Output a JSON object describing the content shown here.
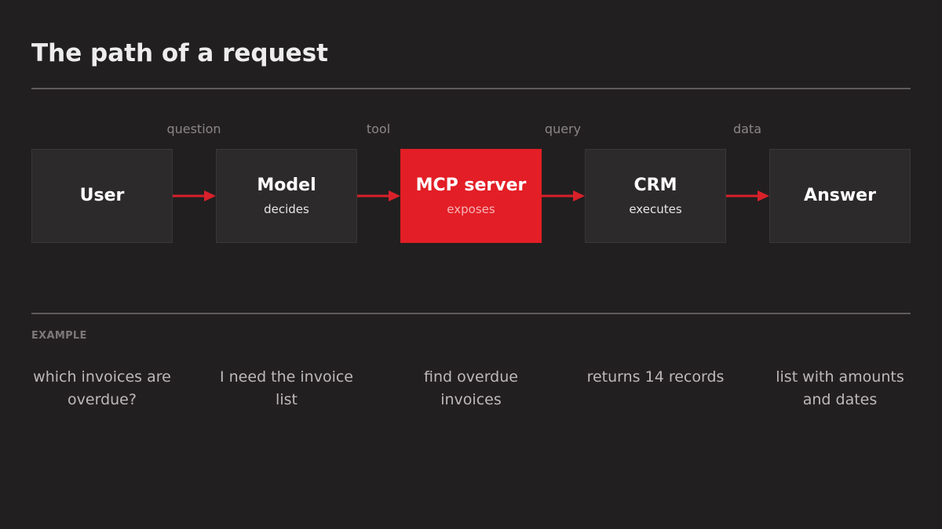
{
  "title": "The path of a request",
  "edges": [
    {
      "label": "question"
    },
    {
      "label": "tool"
    },
    {
      "label": "query"
    },
    {
      "label": "data"
    }
  ],
  "nodes": [
    {
      "name": "User",
      "sub": ""
    },
    {
      "name": "Model",
      "sub": "decides"
    },
    {
      "name": "MCP server",
      "sub": "exposes"
    },
    {
      "name": "CRM",
      "sub": "executes"
    },
    {
      "name": "Answer",
      "sub": ""
    }
  ],
  "example": {
    "label": "EXAMPLE",
    "steps": [
      "which invoices are overdue?",
      "I need the invoice list",
      "find overdue invoices",
      "returns 14 records",
      "list with amounts and dates"
    ]
  },
  "colors": {
    "background": "#221f20",
    "node": "#2d2a2b",
    "highlight": "#e31e26",
    "arrow": "#d8212a",
    "rule": "#5f5b5c"
  }
}
